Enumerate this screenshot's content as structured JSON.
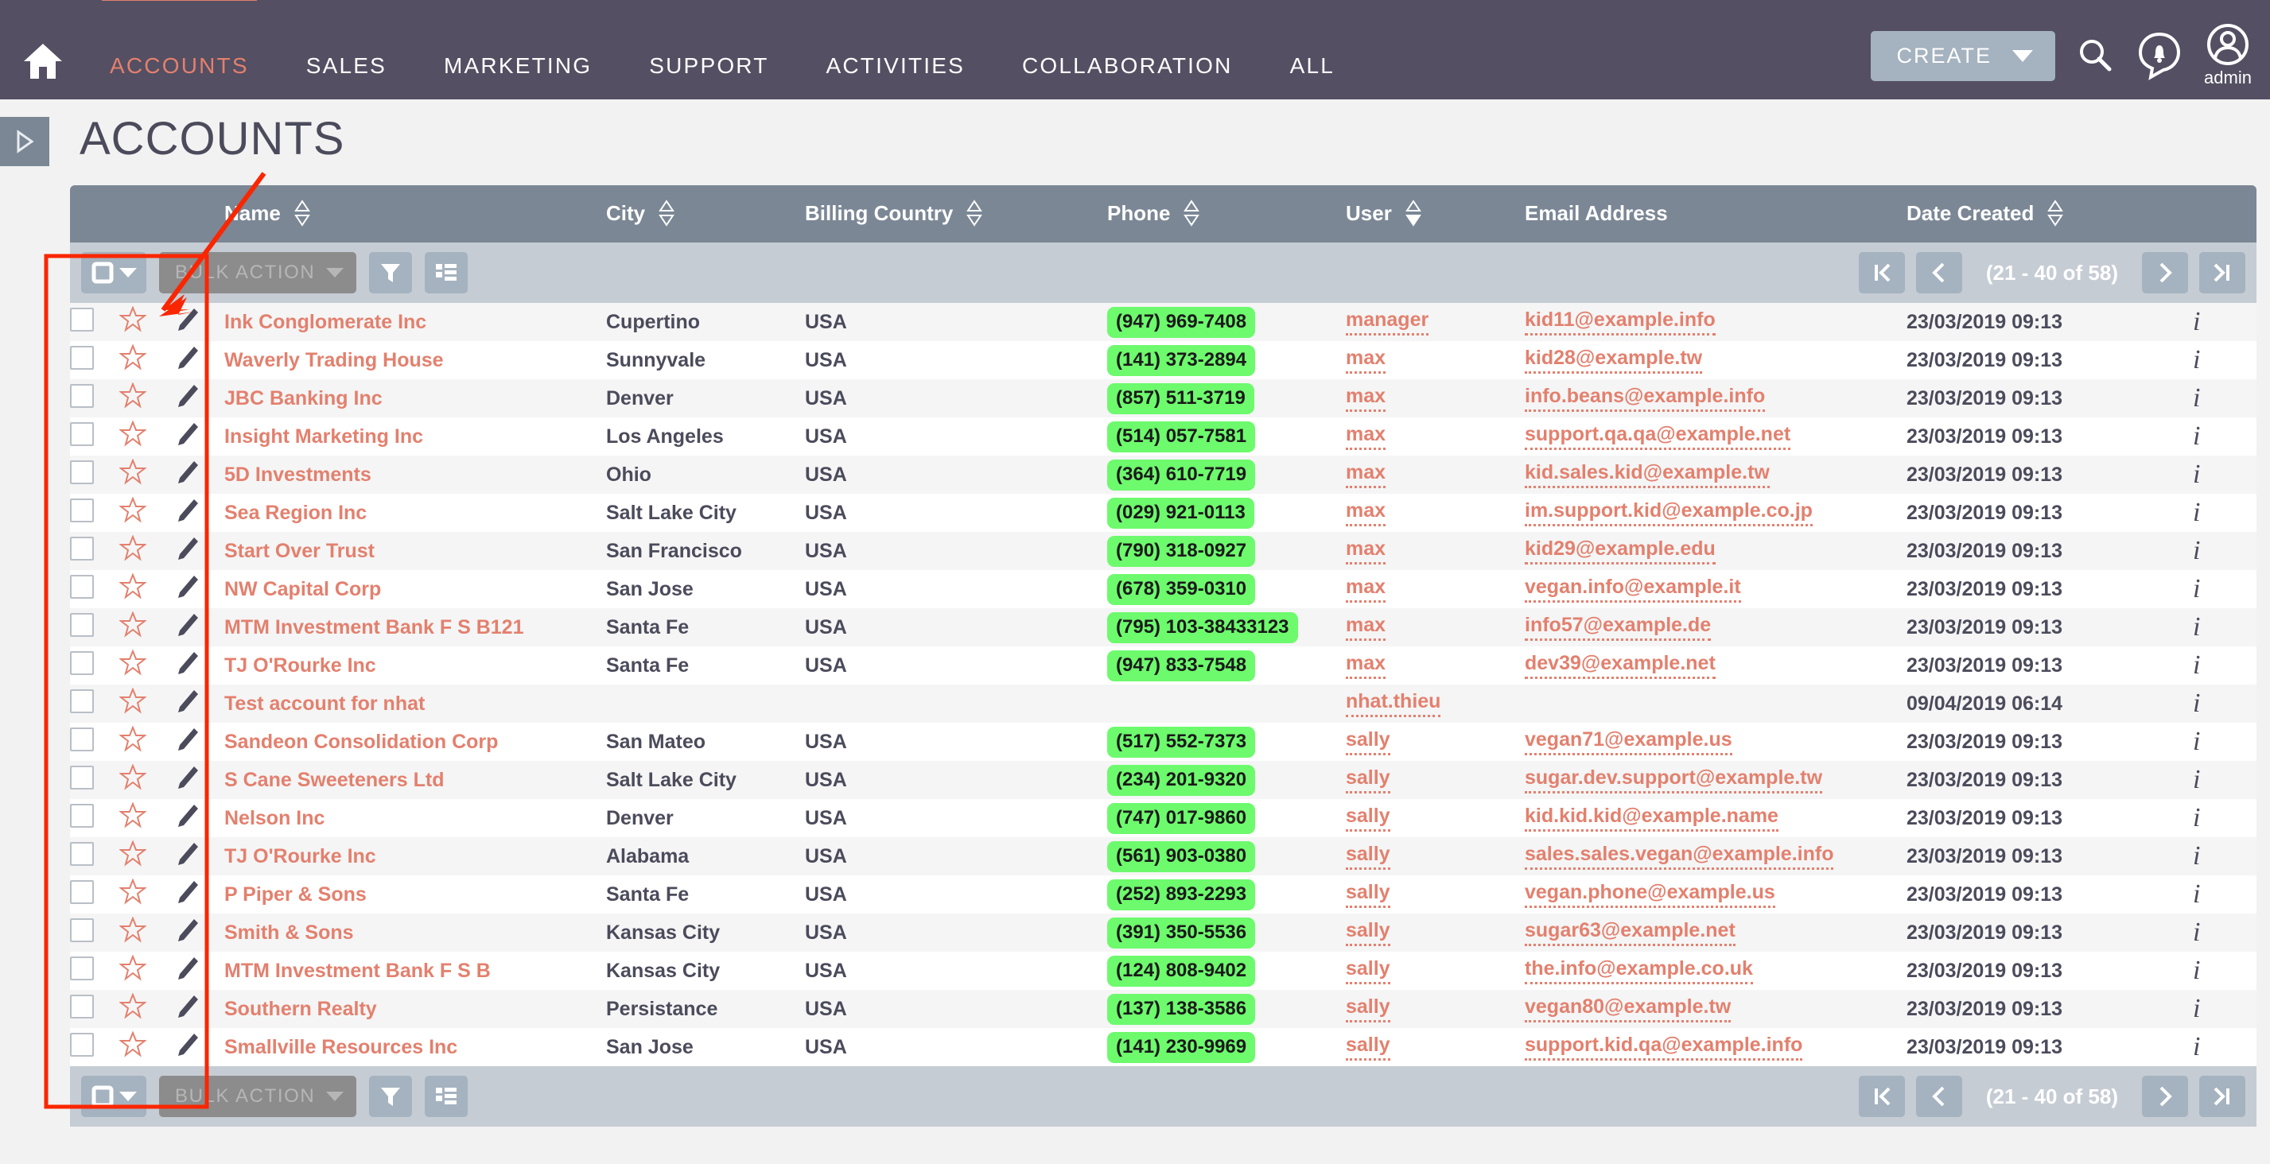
{
  "topnav": {
    "home_icon": "home-icon",
    "items": [
      {
        "label": "ACCOUNTS",
        "active": true
      },
      {
        "label": "SALES",
        "active": false
      },
      {
        "label": "MARKETING",
        "active": false
      },
      {
        "label": "SUPPORT",
        "active": false
      },
      {
        "label": "ACTIVITIES",
        "active": false
      },
      {
        "label": "COLLABORATION",
        "active": false
      },
      {
        "label": "ALL",
        "active": false
      }
    ],
    "create_label": "CREATE",
    "search_icon": "search-icon",
    "notifications_icon": "notification-bell-icon",
    "avatar_icon": "user-avatar-icon",
    "avatar_name": "admin"
  },
  "page": {
    "title": "ACCOUNTS",
    "sidebar_toggle_icon": "expand-sidebar-icon"
  },
  "columns": [
    {
      "label": "Name",
      "sort": "both"
    },
    {
      "label": "City",
      "sort": "both"
    },
    {
      "label": "Billing Country",
      "sort": "both"
    },
    {
      "label": "Phone",
      "sort": "both"
    },
    {
      "label": "User",
      "sort": "desc"
    },
    {
      "label": "Email Address",
      "sort": "none"
    },
    {
      "label": "Date Created",
      "sort": "both"
    }
  ],
  "toolbar": {
    "select_all_icon": "checkbox-dropdown-icon",
    "bulk_action_label": "BULK ACTION",
    "filter_icon": "filter-icon",
    "columns_icon": "column-chooser-icon"
  },
  "pagination": {
    "first_icon": "first-page-icon",
    "prev_icon": "previous-page-icon",
    "count_label": "(21 - 40 of 58)",
    "next_icon": "next-page-icon",
    "last_icon": "last-page-icon"
  },
  "colors": {
    "navbar": "#544f62",
    "accent": "#e3806e",
    "header": "#7b8795",
    "toolbar": "#c5ccd4",
    "phone_pill": "#6dfa6d",
    "annotation": "#fa2600"
  },
  "rows": [
    {
      "name": "Ink Conglomerate Inc",
      "city": "Cupertino",
      "country": "USA",
      "phone": "(947) 969-7408",
      "user": "manager",
      "email": "kid11@example.info",
      "date": "23/03/2019 09:13"
    },
    {
      "name": "Waverly Trading House",
      "city": "Sunnyvale",
      "country": "USA",
      "phone": "(141) 373-2894",
      "user": "max",
      "email": "kid28@example.tw",
      "date": "23/03/2019 09:13"
    },
    {
      "name": "JBC Banking Inc",
      "city": "Denver",
      "country": "USA",
      "phone": "(857) 511-3719",
      "user": "max",
      "email": "info.beans@example.info",
      "date": "23/03/2019 09:13"
    },
    {
      "name": "Insight Marketing Inc",
      "city": "Los Angeles",
      "country": "USA",
      "phone": "(514) 057-7581",
      "user": "max",
      "email": "support.qa.qa@example.net",
      "date": "23/03/2019 09:13"
    },
    {
      "name": "5D Investments",
      "city": "Ohio",
      "country": "USA",
      "phone": "(364) 610-7719",
      "user": "max",
      "email": "kid.sales.kid@example.tw",
      "date": "23/03/2019 09:13"
    },
    {
      "name": "Sea Region Inc",
      "city": "Salt Lake City",
      "country": "USA",
      "phone": "(029) 921-0113",
      "user": "max",
      "email": "im.support.kid@example.co.jp",
      "date": "23/03/2019 09:13"
    },
    {
      "name": "Start Over Trust",
      "city": "San Francisco",
      "country": "USA",
      "phone": "(790) 318-0927",
      "user": "max",
      "email": "kid29@example.edu",
      "date": "23/03/2019 09:13"
    },
    {
      "name": "NW Capital Corp",
      "city": "San Jose",
      "country": "USA",
      "phone": "(678) 359-0310",
      "user": "max",
      "email": "vegan.info@example.it",
      "date": "23/03/2019 09:13"
    },
    {
      "name": "MTM Investment Bank F S B121",
      "city": "Santa Fe",
      "country": "USA",
      "phone": "(795) 103-38433123",
      "user": "max",
      "email": "info57@example.de",
      "date": "23/03/2019 09:13"
    },
    {
      "name": "TJ O'Rourke Inc",
      "city": "Santa Fe",
      "country": "USA",
      "phone": "(947) 833-7548",
      "user": "max",
      "email": "dev39@example.net",
      "date": "23/03/2019 09:13"
    },
    {
      "name": "Test account for nhat",
      "city": "",
      "country": "",
      "phone": "",
      "user": "nhat.thieu",
      "email": "",
      "date": "09/04/2019 06:14"
    },
    {
      "name": "Sandeon Consolidation Corp",
      "city": "San Mateo",
      "country": "USA",
      "phone": "(517) 552-7373",
      "user": "sally",
      "email": "vegan71@example.us",
      "date": "23/03/2019 09:13"
    },
    {
      "name": "S Cane Sweeteners Ltd",
      "city": "Salt Lake City",
      "country": "USA",
      "phone": "(234) 201-9320",
      "user": "sally",
      "email": "sugar.dev.support@example.tw",
      "date": "23/03/2019 09:13"
    },
    {
      "name": "Nelson Inc",
      "city": "Denver",
      "country": "USA",
      "phone": "(747) 017-9860",
      "user": "sally",
      "email": "kid.kid.kid@example.name",
      "date": "23/03/2019 09:13"
    },
    {
      "name": "TJ O'Rourke Inc",
      "city": "Alabama",
      "country": "USA",
      "phone": "(561) 903-0380",
      "user": "sally",
      "email": "sales.sales.vegan@example.info",
      "date": "23/03/2019 09:13"
    },
    {
      "name": "P Piper & Sons",
      "city": "Santa Fe",
      "country": "USA",
      "phone": "(252) 893-2293",
      "user": "sally",
      "email": "vegan.phone@example.us",
      "date": "23/03/2019 09:13"
    },
    {
      "name": "Smith & Sons",
      "city": "Kansas City",
      "country": "USA",
      "phone": "(391) 350-5536",
      "user": "sally",
      "email": "sugar63@example.net",
      "date": "23/03/2019 09:13"
    },
    {
      "name": "MTM Investment Bank F S B",
      "city": "Kansas City",
      "country": "USA",
      "phone": "(124) 808-9402",
      "user": "sally",
      "email": "the.info@example.co.uk",
      "date": "23/03/2019 09:13"
    },
    {
      "name": "Southern Realty",
      "city": "Persistance",
      "country": "USA",
      "phone": "(137) 138-3586",
      "user": "sally",
      "email": "vegan80@example.tw",
      "date": "23/03/2019 09:13"
    },
    {
      "name": "Smallville Resources Inc",
      "city": "San Jose",
      "country": "USA",
      "phone": "(141) 230-9969",
      "user": "sally",
      "email": "support.kid.qa@example.info",
      "date": "23/03/2019 09:13"
    }
  ]
}
